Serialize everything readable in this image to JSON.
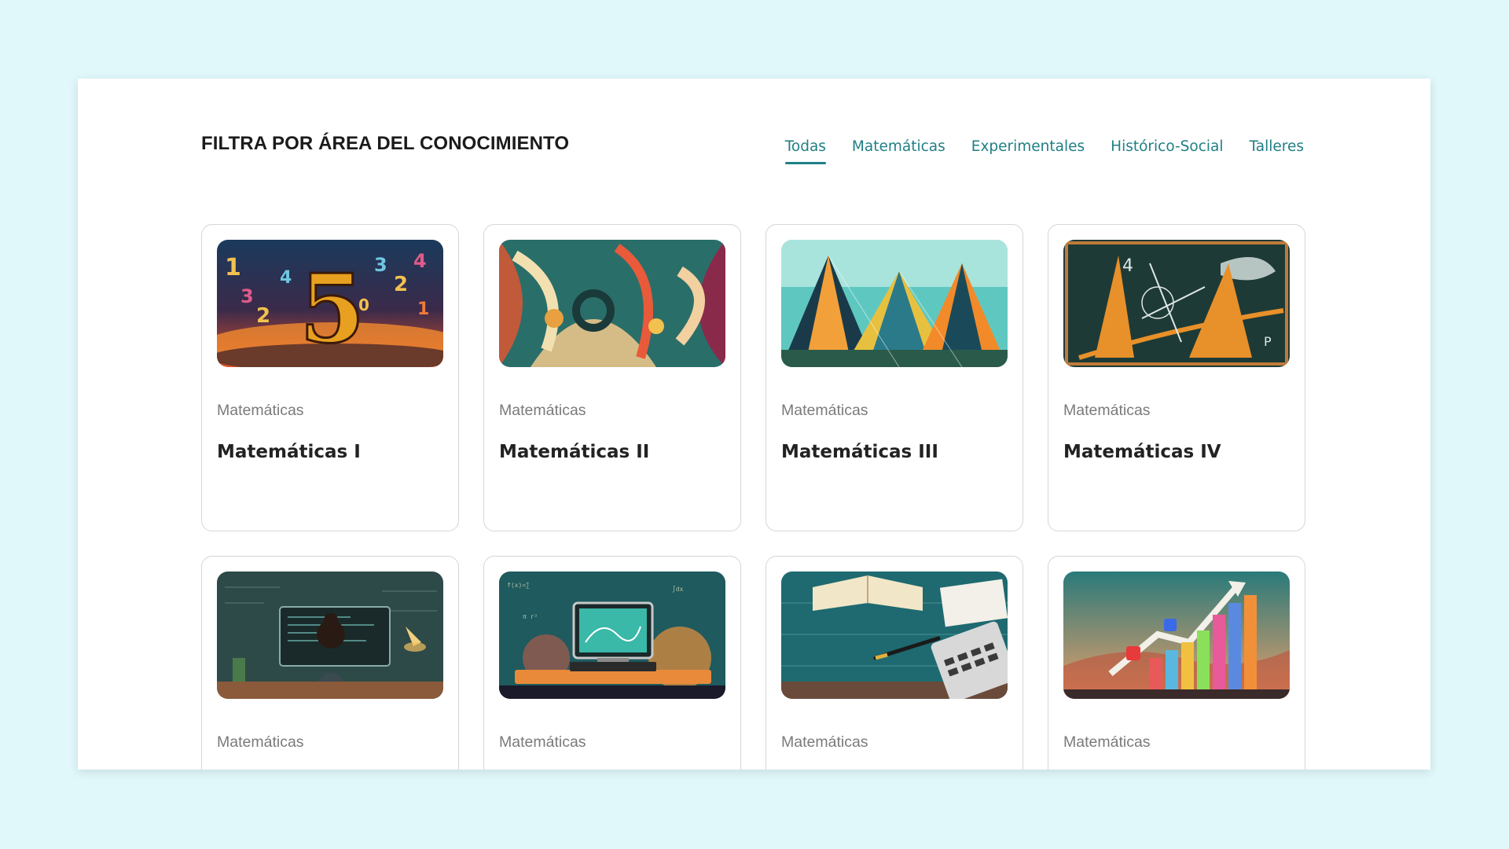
{
  "filter": {
    "title": "FILTRA POR ÁREA DEL CONOCIMIENTO",
    "tabs": [
      {
        "label": "Todas",
        "active": true
      },
      {
        "label": "Matemáticas",
        "active": false
      },
      {
        "label": "Experimentales",
        "active": false
      },
      {
        "label": "Histórico-Social",
        "active": false
      },
      {
        "label": "Talleres",
        "active": false
      }
    ]
  },
  "accent_color": "#207f85",
  "courses": [
    {
      "area": "Matemáticas",
      "title": "Matemáticas I",
      "image": "colorful-numbers-illustration"
    },
    {
      "area": "Matemáticas",
      "title": "Matemáticas II",
      "image": "abstract-numerals-illustration"
    },
    {
      "area": "Matemáticas",
      "title": "Matemáticas III",
      "image": "geometric-mountains-illustration"
    },
    {
      "area": "Matemáticas",
      "title": "Matemáticas IV",
      "image": "chalkboard-geometry-illustration"
    },
    {
      "area": "Matemáticas",
      "image": "programmer-at-computer-illustration"
    },
    {
      "area": "Matemáticas",
      "image": "computer-formulas-illustration"
    },
    {
      "area": "Matemáticas",
      "image": "notebook-calculator-illustration"
    },
    {
      "area": "Matemáticas",
      "image": "statistics-dice-chart-illustration"
    }
  ]
}
